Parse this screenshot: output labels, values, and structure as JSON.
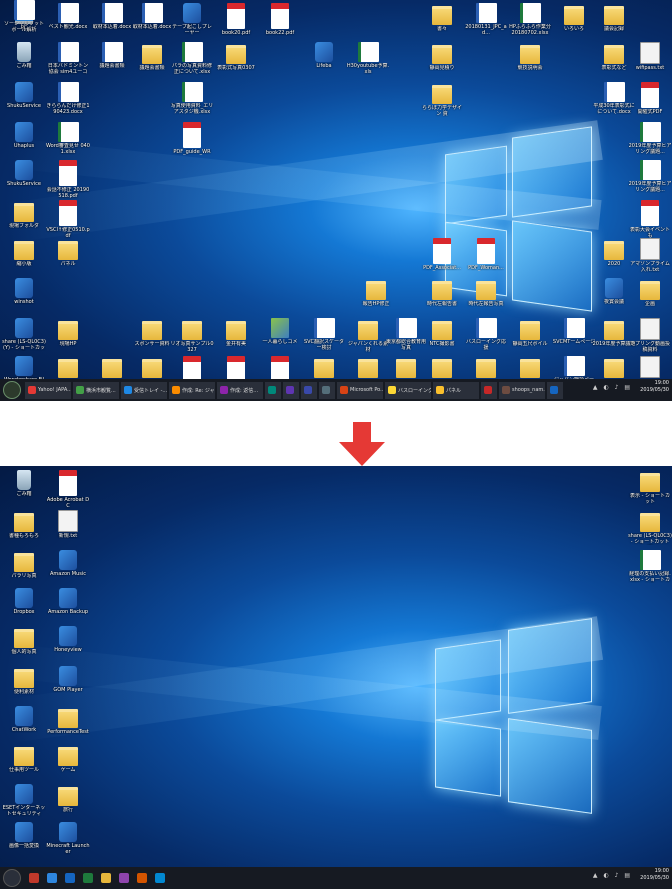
{
  "top": {
    "icons": [
      {
        "label": "PC",
        "kind": "pc"
      },
      {
        "label": "ごみ箱",
        "kind": "bin"
      },
      {
        "label": "ShukuService",
        "kind": "app"
      },
      {
        "label": "Uhaplus",
        "kind": "app"
      },
      {
        "label": "ShukuService",
        "kind": "app"
      },
      {
        "label": "現場フォルダ",
        "kind": "folder"
      },
      {
        "label": "縮小版",
        "kind": "folder"
      },
      {
        "label": "winshot",
        "kind": "app"
      },
      {
        "label": "share (LS-QL0C3) (Y) - ショートカット",
        "kind": "app"
      },
      {
        "label": "Wondershare Filmora",
        "kind": "app"
      },
      {
        "label": "ベスト観光.docx",
        "kind": "doc"
      },
      {
        "label": "日本バドミントン協会 sim4ユーコー...",
        "kind": "doc"
      },
      {
        "label": "きららんだけ修正190423.docx",
        "kind": "doc"
      },
      {
        "label": "Word審査見せ 0401.xlsx",
        "kind": "xls"
      },
      {
        "label": "会話不修正 20190518.pdf",
        "kind": "pdf"
      },
      {
        "label": "VSCI↑修正0510.pdf",
        "kind": "pdf"
      },
      {
        "label": "パネル",
        "kind": "folder"
      },
      {
        "label": "現場HP",
        "kind": "folder"
      },
      {
        "label": "京都商圏",
        "kind": "folder"
      },
      {
        "label": "取材本込着.docx",
        "kind": "doc"
      },
      {
        "label": "議題会書類",
        "kind": "doc"
      },
      {
        "label": "取材本込着.docx",
        "kind": "doc"
      },
      {
        "label": "議題会書類",
        "kind": "folder"
      },
      {
        "label": "テープ起こしプレーヤー",
        "kind": "app"
      },
      {
        "label": "パラの写真資料修正について.xlsx",
        "kind": "xls"
      },
      {
        "label": "写真使用資料_エリアスタジ機.xlsx",
        "kind": "xls"
      },
      {
        "label": "PDF_guide_WR",
        "kind": "pdf"
      },
      {
        "label": "book20.pdf",
        "kind": "pdf"
      },
      {
        "label": "表彰式写真0307",
        "kind": "folder"
      },
      {
        "label": "book22.pdf",
        "kind": "pdf"
      },
      {
        "label": "Lifeba",
        "kind": "app"
      },
      {
        "label": "H30youtube予算.xls",
        "kind": "xls"
      },
      {
        "label": "書々",
        "kind": "folder"
      },
      {
        "label": "静岡見積り",
        "kind": "folder"
      },
      {
        "label": "20180131_JPC_ad...",
        "kind": "doc"
      },
      {
        "label": "HPふらふら作業分20180702.xlsx",
        "kind": "xls"
      },
      {
        "label": "競技説明会",
        "kind": "folder"
      },
      {
        "label": "いろいろ",
        "kind": "folder"
      },
      {
        "label": "議会記録",
        "kind": "folder"
      },
      {
        "label": "表彰式など",
        "kind": "folder"
      },
      {
        "label": "wifipass.txt",
        "kind": "txt"
      },
      {
        "label": "ららぽ力学デザイン 資",
        "kind": "folder"
      },
      {
        "label": "平成30年表彰式にについて.docx",
        "kind": "doc"
      },
      {
        "label": "開催式PDF",
        "kind": "pdf"
      },
      {
        "label": "2019年度予算ヒアリング議題...",
        "kind": "xls"
      },
      {
        "label": "2019年度予算ヒアリング議題...",
        "kind": "xls"
      },
      {
        "label": "表彰大会イベントも",
        "kind": "pdf"
      },
      {
        "label": "PDF_Associat...",
        "kind": "pdf"
      },
      {
        "label": "PDF_Woman...",
        "kind": "pdf"
      },
      {
        "label": "2020",
        "kind": "folder"
      },
      {
        "label": "アマゾンプライム入れ.txt",
        "kind": "txt"
      },
      {
        "label": "報告HP修正",
        "kind": "folder"
      },
      {
        "label": "時代左報告書",
        "kind": "folder"
      },
      {
        "label": "時代左報告写真",
        "kind": "folder"
      },
      {
        "label": "夜賞会議",
        "kind": "app"
      },
      {
        "label": "企画",
        "kind": "folder"
      },
      {
        "label": "スポンサー資料",
        "kind": "folder"
      },
      {
        "label": "リオ写真サンプル0327",
        "kind": "folder"
      },
      {
        "label": "金井有美",
        "kind": "folder"
      },
      {
        "label": "一人暮らしコメ",
        "kind": "img"
      },
      {
        "label": "SVC翻訳スケーター検討",
        "kind": "doc"
      },
      {
        "label": "ジャパンくれる素材",
        "kind": "folder"
      },
      {
        "label": "東京都総合教育用写真",
        "kind": "doc"
      },
      {
        "label": "NTC撮影書",
        "kind": "folder"
      },
      {
        "label": "バスローイング応援",
        "kind": "doc"
      },
      {
        "label": "静岡五尺ボイル",
        "kind": "folder"
      },
      {
        "label": "SVCMTームページ",
        "kind": "doc"
      },
      {
        "label": "2019年度予算議題",
        "kind": "folder"
      },
      {
        "label": "でプリング動画投稿資料",
        "kind": "txt"
      },
      {
        "label": "吉田青郁",
        "kind": "folder"
      },
      {
        "label": "協会HP",
        "kind": "folder"
      },
      {
        "label": "新木来委ビストリー",
        "kind": "pdf"
      },
      {
        "label": "15.pdf",
        "kind": "pdf"
      },
      {
        "label": "08.pdf",
        "kind": "pdf"
      },
      {
        "label": "バラ議題説明",
        "kind": "folder"
      },
      {
        "label": "きらんガイド",
        "kind": "folder"
      },
      {
        "label": "選択送大写真",
        "kind": "folder"
      },
      {
        "label": "NoLimit応用",
        "kind": "folder"
      },
      {
        "label": "スポーツ推進HP修正",
        "kind": "folder"
      },
      {
        "label": "JPSAHP",
        "kind": "folder"
      },
      {
        "label": "ジャパン物語ページ",
        "kind": "doc"
      },
      {
        "label": "JPCページ検討",
        "kind": "folder"
      },
      {
        "label": "新しいテキストドキュメント.txt",
        "kind": "txt"
      },
      {
        "label": "ソーシャルフットボール解析",
        "kind": "doc"
      }
    ],
    "taskbar": {
      "items": [
        "Yahoo! JAPA...",
        "横浜市観覧...",
        "受信トレイ -...",
        "作成: Re: ジャ...",
        "作成: 返信...",
        "",
        "",
        "",
        "",
        "Microsoft Po...",
        "バスローイング...",
        "パネル",
        "",
        "shoops_nam...",
        ""
      ],
      "time": "19:00",
      "date": "2019/05/30"
    }
  },
  "bottom": {
    "icons": [
      {
        "label": "ごみ箱",
        "kind": "bin"
      },
      {
        "label": "Adobe Acrobat DC",
        "kind": "pdf"
      },
      {
        "label": "書種もろもろ",
        "kind": "folder"
      },
      {
        "label": "新規.txt",
        "kind": "txt"
      },
      {
        "label": "パラリ写真",
        "kind": "folder"
      },
      {
        "label": "Amazon Music",
        "kind": "app"
      },
      {
        "label": "Dropbox",
        "kind": "app"
      },
      {
        "label": "Amazon Backup",
        "kind": "app"
      },
      {
        "label": "個人的写真",
        "kind": "folder"
      },
      {
        "label": "Honeyview",
        "kind": "app"
      },
      {
        "label": "便利素材",
        "kind": "folder"
      },
      {
        "label": "GOM Player",
        "kind": "app"
      },
      {
        "label": "ChatWork",
        "kind": "app"
      },
      {
        "label": "PerformanceTest",
        "kind": "folder"
      },
      {
        "label": "仕事用ツール",
        "kind": "folder"
      },
      {
        "label": "ゲーム",
        "kind": "folder"
      },
      {
        "label": "ESETインターネットセキュリティ",
        "kind": "app"
      },
      {
        "label": "旅行",
        "kind": "folder"
      },
      {
        "label": "画像一括変換",
        "kind": "app"
      },
      {
        "label": "Minecraft Launcher",
        "kind": "app"
      },
      {
        "label": "表示 - ショートカット",
        "kind": "folder"
      },
      {
        "label": "share (LS-QL0C3) - ショートカット (2)",
        "kind": "folder"
      },
      {
        "label": "経理の支払い記録.xlsx - ショートカット",
        "kind": "xls"
      }
    ],
    "taskbar": {
      "time": "19:00",
      "date": "2019/05/30"
    }
  },
  "arrow_color": "#e53935"
}
